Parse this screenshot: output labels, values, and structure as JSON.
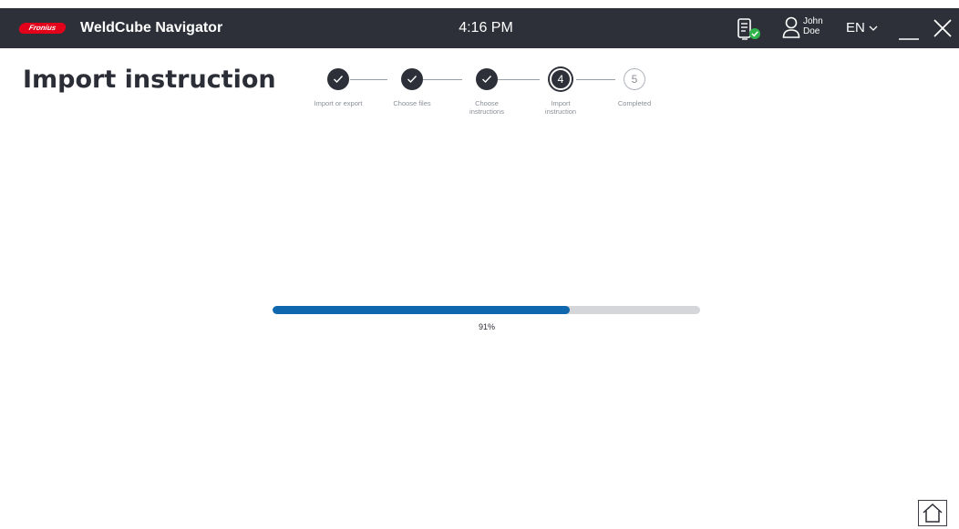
{
  "header": {
    "logo_text": "Fronius",
    "app_title": "WeldCube Navigator",
    "time": "4:16 PM",
    "user": {
      "first_name": "John",
      "last_name": "Doe"
    },
    "language": "EN",
    "icons": [
      "device-status-icon",
      "user-icon",
      "chevron-down-icon",
      "minimize-icon",
      "close-icon"
    ]
  },
  "page": {
    "title": "Import instruction"
  },
  "stepper": {
    "steps": [
      {
        "label": "Import or export",
        "state": "done"
      },
      {
        "label": "Choose files",
        "state": "done"
      },
      {
        "label": "Choose instructions",
        "state": "done"
      },
      {
        "label": "Import instruction",
        "state": "active",
        "number": "4"
      },
      {
        "label": "Completed",
        "state": "pending",
        "number": "5"
      }
    ]
  },
  "progress": {
    "value": 0.695,
    "label": "91%"
  },
  "colors": {
    "header_bg": "#2d3038",
    "brand_red": "#e2001a",
    "progress_fill": "#0f68ad",
    "progress_track": "#d4d6d9",
    "status_ok": "#2fb34a"
  },
  "footer": {
    "home_icon": "home-icon"
  }
}
